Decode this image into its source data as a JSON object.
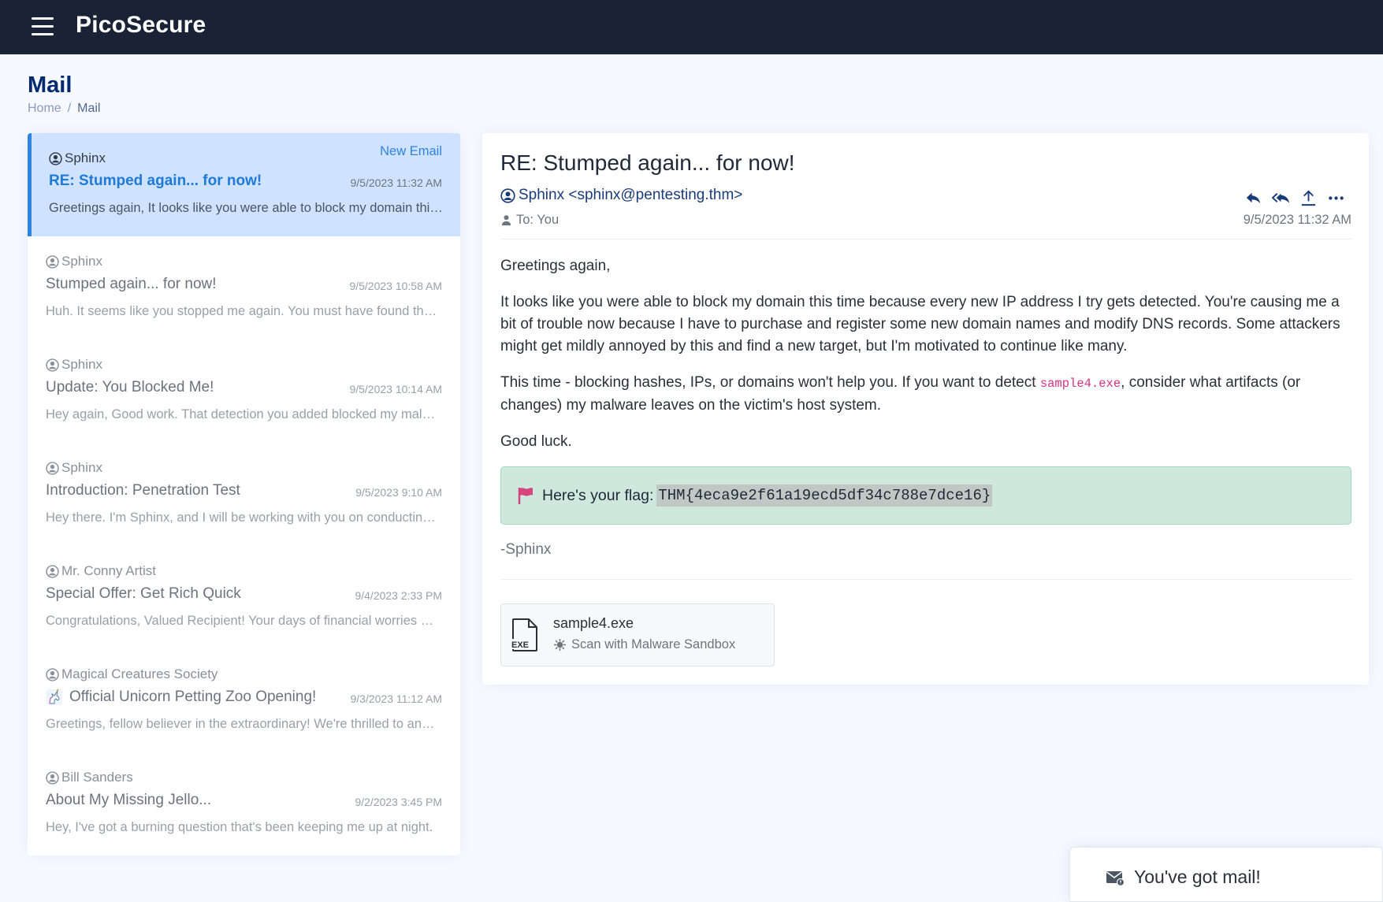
{
  "app": {
    "brand": "PicoSecure"
  },
  "page": {
    "title": "Mail",
    "breadcrumb": {
      "home": "Home",
      "current": "Mail",
      "separator": "/"
    }
  },
  "inbox": {
    "new_email_label": "New Email",
    "emails": [
      {
        "sender": "Sphinx",
        "subject": "RE: Stumped again... for now!",
        "date": "9/5/2023 11:32 AM",
        "preview": "Greetings again, It looks like you were able to block my domain this time because every new IP address I try gets detected.",
        "active": true
      },
      {
        "sender": "Sphinx",
        "subject": "Stumped again... for now!",
        "date": "9/5/2023 10:58 AM",
        "preview": "Huh. It seems like you stopped me again. You must have found the new IP addresses I used."
      },
      {
        "sender": "Sphinx",
        "subject": "Update: You Blocked Me!",
        "date": "9/5/2023 10:14 AM",
        "preview": "Hey again, Good work. That detection you added blocked my malware from running."
      },
      {
        "sender": "Sphinx",
        "subject": "Introduction: Penetration Test",
        "date": "9/5/2023 9:10 AM",
        "preview": "Hey there. I'm Sphinx, and I will be working with you on conducting a penetration test."
      },
      {
        "sender": "Mr. Conny Artist",
        "subject": "Special Offer: Get Rich Quick",
        "date": "9/4/2023 2:33 PM",
        "preview": "Congratulations, Valued Recipient! Your days of financial worries are over."
      },
      {
        "sender": "Magical Creatures Society",
        "subject": "Official Unicorn Petting Zoo Opening!",
        "date": "9/3/2023 11:12 AM",
        "preview": "Greetings, fellow believer in the extraordinary! We're thrilled to announce the opening.",
        "icon": "unicorn-icon"
      },
      {
        "sender": "Bill Sanders",
        "subject": "About My Missing Jello...",
        "date": "9/2/2023 3:45 PM",
        "preview": "Hey, I've got a burning question that's been keeping me up at night."
      }
    ]
  },
  "message": {
    "subject": "RE: Stumped again... for now!",
    "from": "Sphinx <sphinx@pentesting.thm>",
    "to": "To: You",
    "date": "9/5/2023 11:32 AM",
    "body": {
      "greeting": "Greetings again,",
      "para1": "It looks like you were able to block my domain this time because every new IP address I try gets detected. You're causing me a bit of trouble now because I have to purchase and register some new domain names and modify DNS records. Some attackers might get mildly annoyed by this and find a new target, but I'm motivated to continue like many.",
      "para2_before": "This time - blocking hashes, IPs, or domains won't help you. If you want to detect ",
      "para2_code": "sample4.exe",
      "para2_after": ", consider what artifacts (or changes) my malware leaves on the victim's host system.",
      "closing": "Good luck."
    },
    "flag": {
      "label": "Here's your flag:",
      "value": "THM{4eca9e2f61a19ecd5df34c788e7dce16}"
    },
    "signature": "-Sphinx",
    "attachment": {
      "name": "sample4.exe",
      "file_type": "EXE",
      "action": "Scan with Malware Sandbox"
    },
    "actions": [
      "reply-icon",
      "reply-all-icon",
      "forward-icon",
      "more-icon"
    ]
  },
  "toast": {
    "title": "You've got mail!"
  },
  "colors": {
    "topbar": "#1a2236",
    "accent": "#2f83e3",
    "active_row": "#cfe2ff",
    "flag_bg": "#cfe8de",
    "title": "#012970"
  }
}
